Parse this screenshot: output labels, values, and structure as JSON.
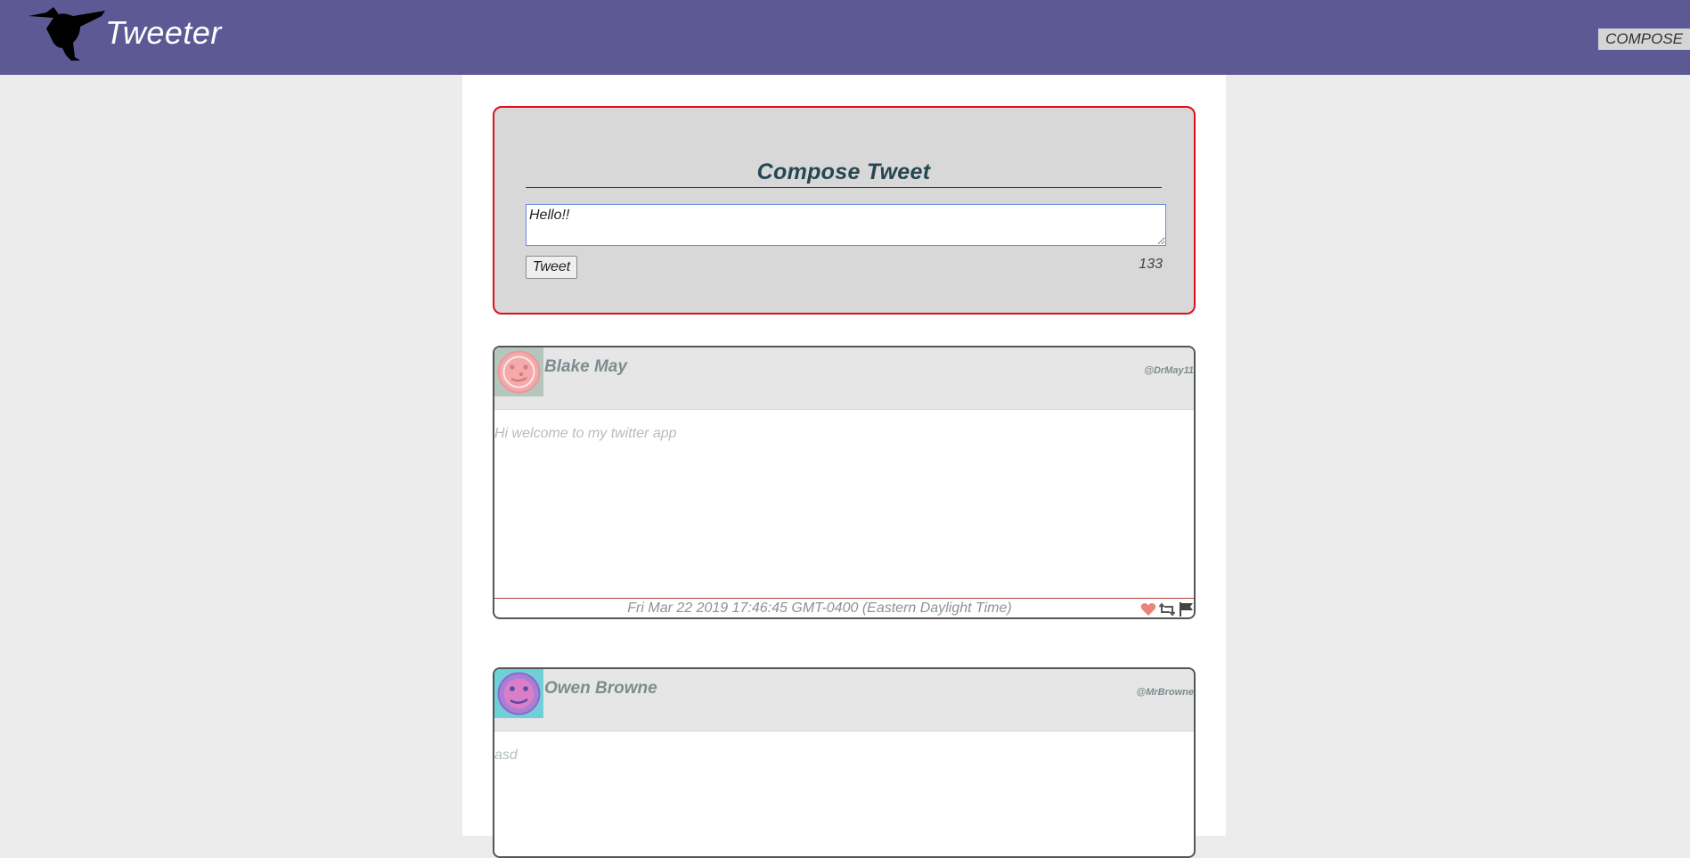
{
  "app": {
    "brand": "Tweeter",
    "compose_label": "COMPOSE",
    "colors": {
      "navbar": "#5d5995",
      "compose_border": "#e0101a",
      "title": "#244751"
    }
  },
  "compose": {
    "title": "Compose Tweet",
    "textarea_value": "Hello!!",
    "tweet_button": "Tweet",
    "char_count": "133"
  },
  "tweets": [
    {
      "name": "Blake May",
      "handle": "@DrMay11",
      "text": "Hi welcome to my twitter app",
      "timestamp": "Fri Mar 22 2019 17:46:45 GMT-0400 (Eastern Daylight Time)",
      "avatar_colors": {
        "bg": "#b5c7bd",
        "face": "#f4a9ab"
      },
      "actions": [
        "heart-icon",
        "retweet-icon",
        "flag-icon"
      ]
    },
    {
      "name": "Owen Browne",
      "handle": "@MrBrowne",
      "text": "asd",
      "avatar_colors": {
        "bg": "#6fd0d8",
        "face": "#a87fd8"
      }
    }
  ]
}
